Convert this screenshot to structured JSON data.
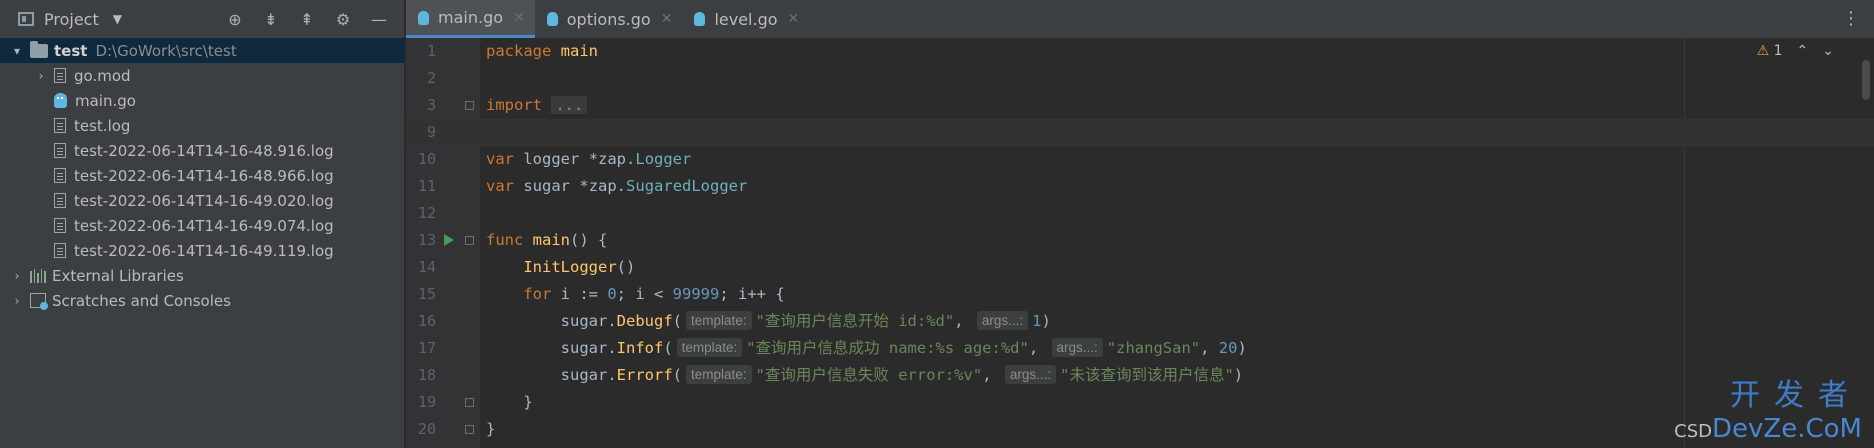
{
  "project_panel": {
    "title": "Project",
    "tools": [
      "locate-icon",
      "expand-all-icon",
      "collapse-all-icon",
      "settings-icon",
      "hide-icon"
    ],
    "root": {
      "name": "test",
      "path": "D:\\GoWork\\src\\test"
    },
    "files": [
      "go.mod",
      "main.go",
      "test.log",
      "test-2022-06-14T14-16-48.916.log",
      "test-2022-06-14T14-16-48.966.log",
      "test-2022-06-14T14-16-49.020.log",
      "test-2022-06-14T14-16-49.074.log",
      "test-2022-06-14T14-16-49.119.log"
    ],
    "external_libraries": "External Libraries",
    "scratches": "Scratches and Consoles"
  },
  "tabs": [
    {
      "label": "main.go",
      "active": true
    },
    {
      "label": "options.go",
      "active": false
    },
    {
      "label": "level.go",
      "active": false
    }
  ],
  "editor": {
    "line_numbers": [
      "1",
      "2",
      "3",
      "9",
      "10",
      "11",
      "12",
      "13",
      "14",
      "15",
      "16",
      "17",
      "18",
      "19",
      "20"
    ],
    "inspection_count": "1",
    "fold_placeholder": "...",
    "hints": {
      "template": "template:",
      "args": "args...:"
    },
    "code": {
      "package_kw": "package",
      "package_name": "main",
      "import_kw": "import",
      "var_kw": "var",
      "logger_name": "logger",
      "logger_pkg": "*zap.",
      "logger_type": "Logger",
      "sugar_name": "sugar",
      "sugar_pkg": "*zap.",
      "sugar_type": "SugaredLogger",
      "func_kw": "func",
      "main_fn": "main",
      "main_rest": "() {",
      "init_call": "InitLogger",
      "init_rest": "()",
      "for_kw": "for",
      "for_a": " i := ",
      "zero": "0",
      "for_b": "; i < ",
      "limit": "99999",
      "for_c": "; i++ {",
      "debug_recv": "sugar.",
      "debug_fn": "Debugf",
      "debug_str": "\"查询用户信息开始 id:%d\"",
      "debug_arg": "1",
      "info_recv": "sugar.",
      "info_fn": "Infof",
      "info_str": "\"查询用户信息成功 name:%s age:%d\"",
      "info_arg1": "\"zhangSan\"",
      "info_arg2": "20",
      "error_recv": "sugar.",
      "error_fn": "Errorf",
      "error_str": "\"查询用户信息失败 error:%v\"",
      "error_arg": "\"未该查询到该用户信息\"",
      "close_inner": "}",
      "close_outer": "}"
    }
  },
  "watermark": {
    "line1": "开发者",
    "prefix": "CSD",
    "brand": "DevZe.CoM"
  }
}
